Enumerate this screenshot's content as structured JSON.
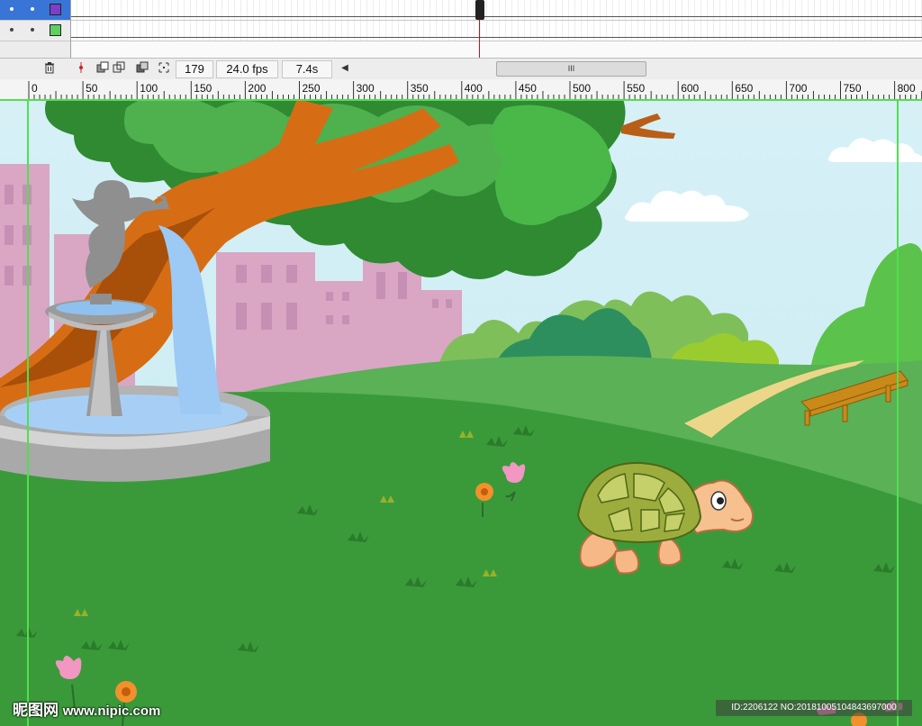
{
  "timeline": {
    "layers": [
      {
        "selected": true,
        "color": "#7b3fc9"
      },
      {
        "selected": false,
        "color": "#5fd05f"
      }
    ]
  },
  "status_bar": {
    "current_frame": "179",
    "fps": "24.0 fps",
    "elapsed": "7.4s",
    "scroll_grip": "III"
  },
  "ruler": {
    "labels": [
      "0",
      "50",
      "100",
      "150",
      "200",
      "250",
      "300",
      "350",
      "400",
      "450",
      "500",
      "550",
      "600",
      "650",
      "700",
      "750",
      "800"
    ]
  },
  "watermark": {
    "logo": "昵图网",
    "site": "www.nipic.com",
    "id_text": "ID:2206122 NO:20181005104843697000"
  },
  "colors": {
    "sky": "#cfeef4",
    "grass": "#3a9a3a",
    "tree_trunk": "#d66d14",
    "stage_guide": "#4fe04f"
  }
}
